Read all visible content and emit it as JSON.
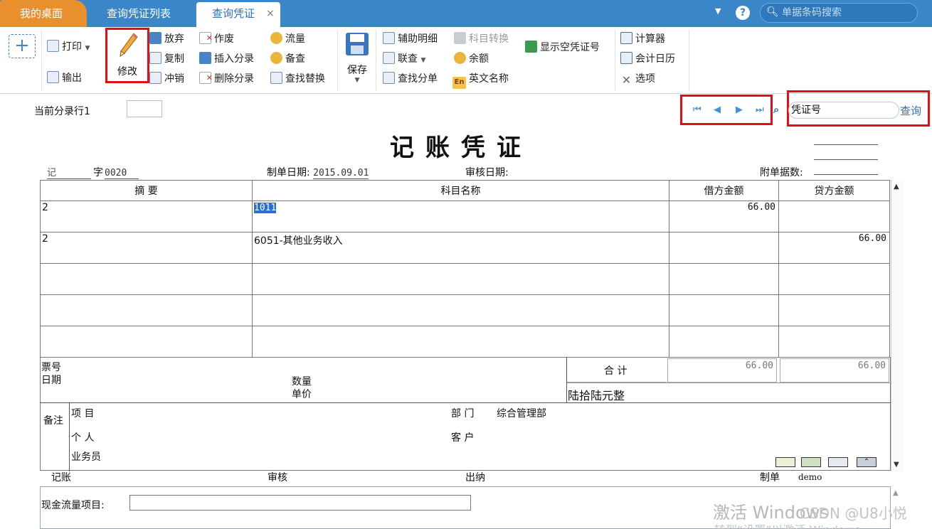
{
  "tabs": {
    "home": "我的桌面",
    "list": "查询凭证列表",
    "active": "查询凭证",
    "close": "×"
  },
  "topbar": {
    "help": "?",
    "search_placeholder": "单据条码搜索"
  },
  "toolbar": {
    "add": "+",
    "print": "打印",
    "export": "输出",
    "modify": "修改",
    "discard": "放弃",
    "copy": "复制",
    "reverse": "冲销",
    "void": "作废",
    "insert_entry": "插入分录",
    "delete_entry": "删除分录",
    "flow": "流量",
    "memo": "备查",
    "find_replace": "查找替换",
    "save": "保存",
    "aux_detail": "辅助明细",
    "subject_convert": "科目转换",
    "linked_query": "联查",
    "balance": "余额",
    "find_entry": "查找分单",
    "english_name": "英文名称",
    "show_empty_no": "显示空凭证号",
    "calculator": "计算器",
    "calendar": "会计日历",
    "options": "选项",
    "en_icon": "En"
  },
  "voucher_nav": {
    "current_row_label": "当前分录行1",
    "voucher_no_value": "凭证号",
    "query_link": "查询"
  },
  "voucher": {
    "title": "记账凭证",
    "type": "记",
    "zi": "字",
    "number": "0020",
    "date_label": "制单日期:",
    "date": "2015.09.01",
    "audit_date_label": "审核日期:",
    "attachments_label": "附单据数:",
    "columns": [
      "摘 要",
      "科目名称",
      "借方金额",
      "贷方金额"
    ],
    "rows": [
      {
        "summary": "2",
        "subject": "1011",
        "debit": "66.00",
        "credit": ""
      },
      {
        "summary": "2",
        "subject": "6051-其他业务收入",
        "debit": "",
        "credit": "66.00"
      },
      {
        "summary": "",
        "subject": "",
        "debit": "",
        "credit": ""
      },
      {
        "summary": "",
        "subject": "",
        "debit": "",
        "credit": ""
      },
      {
        "summary": "",
        "subject": "",
        "debit": "",
        "credit": ""
      }
    ],
    "ticket_no": "票号",
    "date_small": "日期",
    "quantity": "数量",
    "unit_price": "单价",
    "total_label": "合 计",
    "total_debit": "66.00",
    "total_credit": "66.00",
    "total_words": "陆拾陆元整",
    "notes_label": "备注",
    "project_label": "项 目",
    "dept_label": "部 门",
    "dept_value": "综合管理部",
    "person_label": "个 人",
    "customer_label": "客 户",
    "salesman_label": "业务员",
    "bookkeep_label": "记账",
    "audit_label": "审核",
    "cashier_label": "出纳",
    "maker_label": "制单",
    "maker_value": "demo",
    "cashflow_label": "现金流量项目:"
  },
  "watermarks": {
    "activate": "激活 Windows",
    "hint": "转到“设置”以激活 Windows",
    "csdn": "CSDN @U8小悦"
  }
}
